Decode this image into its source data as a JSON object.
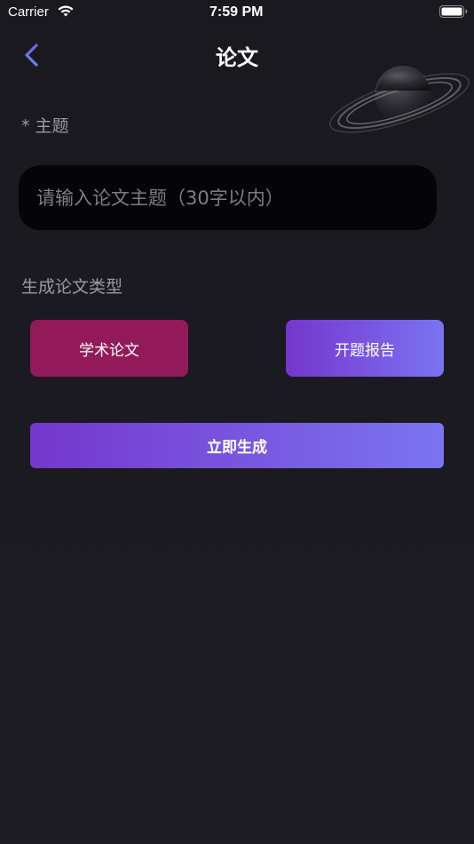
{
  "status_bar": {
    "carrier": "Carrier",
    "time": "7:59 PM",
    "wifi_icon": "wifi-icon",
    "battery_icon": "battery-icon"
  },
  "nav": {
    "title": "论文",
    "back_icon": "chevron-left-icon",
    "back_icon_gradient": [
      "#7a5cf0",
      "#5a8ee8"
    ],
    "decoration_icon": "planet-icon"
  },
  "form": {
    "topic_required_mark": "*",
    "topic_label": "主题",
    "topic_input": {
      "value": "",
      "placeholder": "请输入论文主题（30字以内）"
    },
    "type_label": "生成论文类型",
    "types": [
      {
        "label": "学术论文",
        "color": "#931a59"
      },
      {
        "label": "开题报告",
        "color_start": "#7537cc",
        "color_end": "#7b73f2"
      }
    ],
    "generate_label": "立即生成"
  },
  "colors": {
    "background": "#1b1a21",
    "input_background": "#050408",
    "muted_text": "#9a99a0",
    "accent_start": "#7537cc",
    "accent_end": "#7b74f2",
    "academic_button": "#931a59"
  }
}
